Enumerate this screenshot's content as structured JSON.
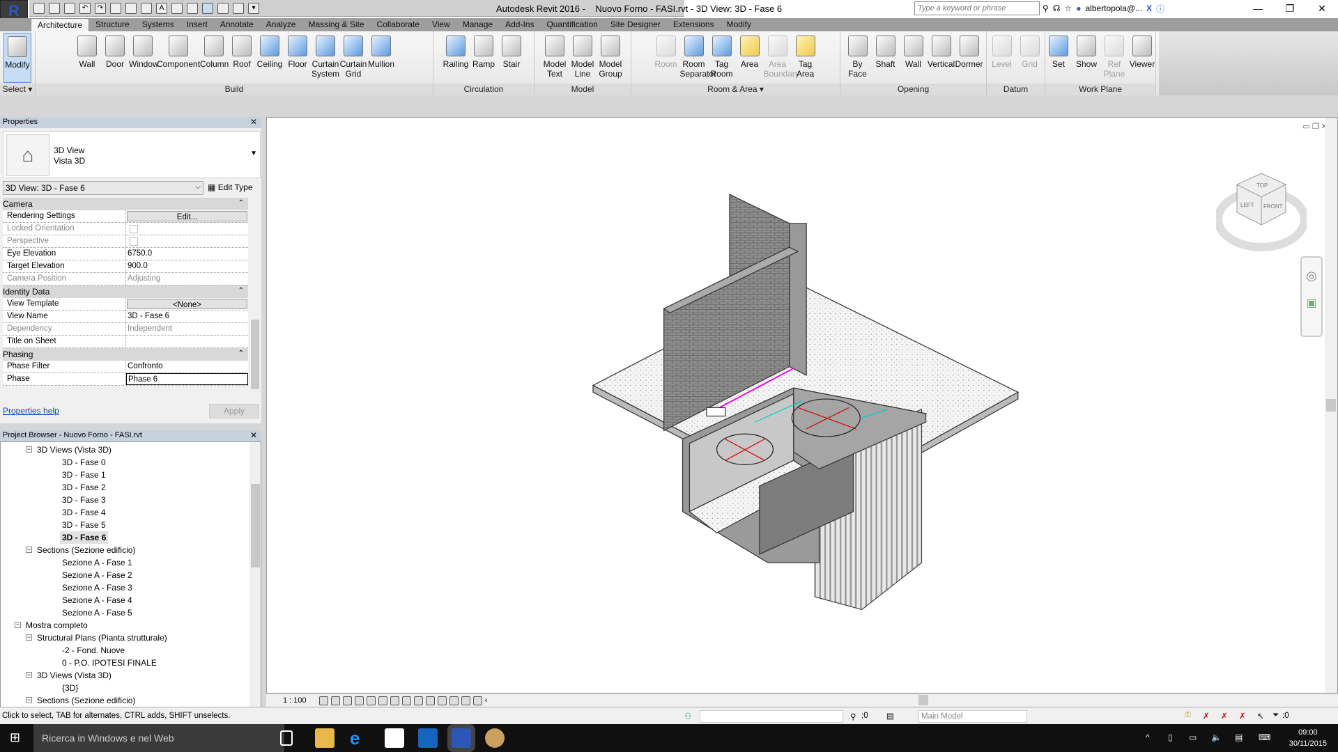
{
  "app": {
    "title": "Autodesk Revit 2016 -    Nuovo Forno - FASI.rvt - 3D View: 3D - Fase 6",
    "search_placeholder": "Type a keyword or phrase",
    "user": "albertopola@...",
    "accent": "#5d95d0"
  },
  "tabs": [
    "Architecture",
    "Structure",
    "Systems",
    "Insert",
    "Annotate",
    "Analyze",
    "Massing & Site",
    "Collaborate",
    "View",
    "Manage",
    "Add-Ins",
    "Quantification",
    "Site Designer",
    "Extensions",
    "Modify"
  ],
  "ribbon": [
    {
      "label": "Select ▾",
      "buttons": [
        {
          "label": "Modify",
          "icon": "cursor-icon",
          "state": "selected"
        }
      ]
    },
    {
      "label": "Build",
      "buttons": [
        {
          "label": "Wall",
          "icon": "wall-icon"
        },
        {
          "label": "Door",
          "icon": "door-icon"
        },
        {
          "label": "Window",
          "icon": "window-icon"
        },
        {
          "label": "Component",
          "icon": "component-icon"
        },
        {
          "label": "Column",
          "icon": "column-icon"
        },
        {
          "label": "Roof",
          "icon": "roof-icon"
        },
        {
          "label": "Ceiling",
          "icon": "ceiling-icon",
          "color": "blue"
        },
        {
          "label": "Floor",
          "icon": "floor-icon",
          "color": "blue"
        },
        {
          "label": "Curtain System",
          "icon": "curtain-system-icon",
          "color": "blue"
        },
        {
          "label": "Curtain Grid",
          "icon": "curtain-grid-icon",
          "color": "blue"
        },
        {
          "label": "Mullion",
          "icon": "mullion-icon",
          "color": "blue"
        }
      ]
    },
    {
      "label": "Circulation",
      "buttons": [
        {
          "label": "Railing",
          "icon": "railing-icon",
          "color": "blue"
        },
        {
          "label": "Ramp",
          "icon": "ramp-icon"
        },
        {
          "label": "Stair",
          "icon": "stair-icon"
        }
      ]
    },
    {
      "label": "Model",
      "buttons": [
        {
          "label": "Model Text",
          "icon": "model-text-icon"
        },
        {
          "label": "Model Line",
          "icon": "model-line-icon"
        },
        {
          "label": "Model Group",
          "icon": "model-group-icon"
        }
      ]
    },
    {
      "label": "Room & Area ▾",
      "buttons": [
        {
          "label": "Room",
          "icon": "room-icon",
          "state": "disabled"
        },
        {
          "label": "Room Separator",
          "icon": "room-separator-icon",
          "color": "blue"
        },
        {
          "label": "Tag Room",
          "icon": "tag-room-icon",
          "color": "blue"
        },
        {
          "label": "Area",
          "icon": "area-icon",
          "color": "yellow"
        },
        {
          "label": "Area Boundary",
          "icon": "area-boundary-icon",
          "state": "disabled"
        },
        {
          "label": "Tag Area",
          "icon": "tag-area-icon",
          "color": "yellow"
        }
      ]
    },
    {
      "label": "Opening",
      "buttons": [
        {
          "label": "By Face",
          "icon": "opening-by-face-icon"
        },
        {
          "label": "Shaft",
          "icon": "shaft-icon"
        },
        {
          "label": "Wall",
          "icon": "wall-opening-icon"
        },
        {
          "label": "Vertical",
          "icon": "vertical-opening-icon"
        },
        {
          "label": "Dormer",
          "icon": "dormer-icon"
        }
      ]
    },
    {
      "label": "Datum",
      "buttons": [
        {
          "label": "Level",
          "icon": "level-icon",
          "state": "disabled"
        },
        {
          "label": "Grid",
          "icon": "grid-icon",
          "state": "disabled"
        }
      ]
    },
    {
      "label": "Work Plane",
      "buttons": [
        {
          "label": "Set",
          "icon": "set-workplane-icon",
          "color": "blue"
        },
        {
          "label": "Show",
          "icon": "show-workplane-icon"
        },
        {
          "label": "Ref Plane",
          "icon": "ref-plane-icon",
          "state": "disabled"
        },
        {
          "label": "Viewer",
          "icon": "viewer-icon"
        }
      ]
    }
  ],
  "properties": {
    "title": "Properties",
    "type_line1": "3D View",
    "type_line2": "Vista 3D",
    "instance_selector": "3D View: 3D - Fase 6",
    "edit_type": "Edit Type",
    "sections": [
      {
        "name": "Camera",
        "rows": [
          {
            "key": "Rendering Settings",
            "value": "Edit...",
            "kind": "button"
          },
          {
            "key": "Locked Orientation",
            "value": "",
            "kind": "checkbox",
            "dim": true,
            "checked": false
          },
          {
            "key": "Perspective",
            "value": "",
            "kind": "checkbox",
            "dim": true,
            "checked": false
          },
          {
            "key": "Eye Elevation",
            "value": "6750.0"
          },
          {
            "key": "Target Elevation",
            "value": "900.0"
          },
          {
            "key": "Camera Position",
            "value": "Adjusting",
            "dim": true
          }
        ]
      },
      {
        "name": "Identity Data",
        "rows": [
          {
            "key": "View Template",
            "value": "<None>",
            "kind": "button"
          },
          {
            "key": "View Name",
            "value": "3D - Fase 6"
          },
          {
            "key": "Dependency",
            "value": "Independent",
            "dim": true
          },
          {
            "key": "Title on Sheet",
            "value": ""
          }
        ]
      },
      {
        "name": "Phasing",
        "rows": [
          {
            "key": "Phase Filter",
            "value": "Confronto"
          },
          {
            "key": "Phase",
            "value": "Phase 6",
            "kind": "editing"
          }
        ]
      }
    ],
    "help_link": "Properties help",
    "apply": "Apply"
  },
  "browser": {
    "title": "Project Browser - Nuovo Forno - FASI.rvt",
    "items": [
      {
        "label": "3D Views (Vista 3D)",
        "level": 2,
        "expanded": true
      },
      {
        "label": "3D - Fase 0",
        "level": 3
      },
      {
        "label": "3D - Fase 1",
        "level": 3
      },
      {
        "label": "3D - Fase 2",
        "level": 3
      },
      {
        "label": "3D - Fase 3",
        "level": 3
      },
      {
        "label": "3D - Fase 4",
        "level": 3
      },
      {
        "label": "3D - Fase 5",
        "level": 3
      },
      {
        "label": "3D - Fase 6",
        "level": 3,
        "selected": true
      },
      {
        "label": "Sections (Sezione edificio)",
        "level": 2,
        "expanded": true
      },
      {
        "label": "Sezione A - Fase 1",
        "level": 3
      },
      {
        "label": "Sezione A - Fase 2",
        "level": 3
      },
      {
        "label": "Sezione A - Fase 3",
        "level": 3
      },
      {
        "label": "Sezione A - Fase 4",
        "level": 3
      },
      {
        "label": "Sezione A - Fase 5",
        "level": 3
      },
      {
        "label": "Mostra completo",
        "level": 1,
        "expanded": true
      },
      {
        "label": "Structural Plans (Pianta strutturale)",
        "level": 2,
        "expanded": true
      },
      {
        "label": "-2 - Fond. Nuove",
        "level": 3
      },
      {
        "label": "0 - P.O. IPOTESI FINALE",
        "level": 3
      },
      {
        "label": "3D Views (Vista 3D)",
        "level": 2,
        "expanded": true
      },
      {
        "label": "{3D}",
        "level": 3
      },
      {
        "label": "Sections (Sezione edificio)",
        "level": 2,
        "expanded": true
      }
    ]
  },
  "viewcube": {
    "top": "TOP",
    "left": "LEFT",
    "front": "FRONT"
  },
  "view_control": {
    "scale": "1 : 100"
  },
  "statusbar": {
    "message": "Click to select, TAB for alternates, CTRL adds, SHIFT unselects.",
    "workset_count": ":0",
    "design_option": "Main Model",
    "filter_count": ":0"
  },
  "taskbar": {
    "search": "Ricerca in Windows e nel Web",
    "time": "09:00",
    "date": "30/11/2015"
  }
}
